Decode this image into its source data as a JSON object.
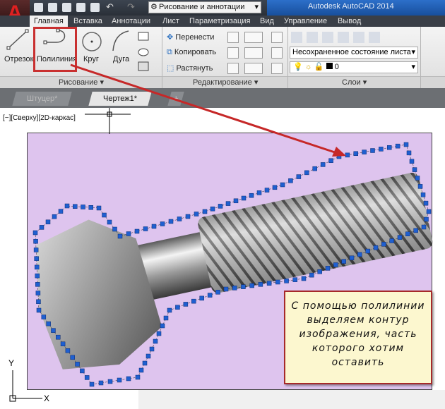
{
  "app_title": "Autodesk AutoCAD 2014",
  "workspace": "Рисование и аннотации",
  "ribbon_tabs": [
    "Главная",
    "Вставка",
    "Аннотации",
    "Лист",
    "Параметризация",
    "Вид",
    "Управление",
    "Вывод"
  ],
  "draw_panel": {
    "line": "Отрезок",
    "polyline": "Полилиния",
    "circle": "Круг",
    "arc": "Дуга",
    "label": "Рисование ▾"
  },
  "modify_panel": {
    "move": "Перенести",
    "copy": "Копировать",
    "stretch": "Растянуть",
    "label": "Редактирование ▾"
  },
  "layers_panel": {
    "layer_state": "Несохраненное состояние листа",
    "current_layer": "0",
    "label": "Слои ▾"
  },
  "doc_tabs": [
    "Штуцер*",
    "Чертеж1*"
  ],
  "viewport_label": "[−][Сверху][2D-каркас]",
  "callout_lines": [
    "С помощью полилинии",
    "выделяем контур",
    "изображения, часть",
    "которого хотим",
    "оставить"
  ],
  "ucs": {
    "y": "Y",
    "x": "X"
  },
  "colors": {
    "highlight": "#c93030",
    "selection": "#1f5fd0",
    "image_bg": "#dec4ee"
  }
}
